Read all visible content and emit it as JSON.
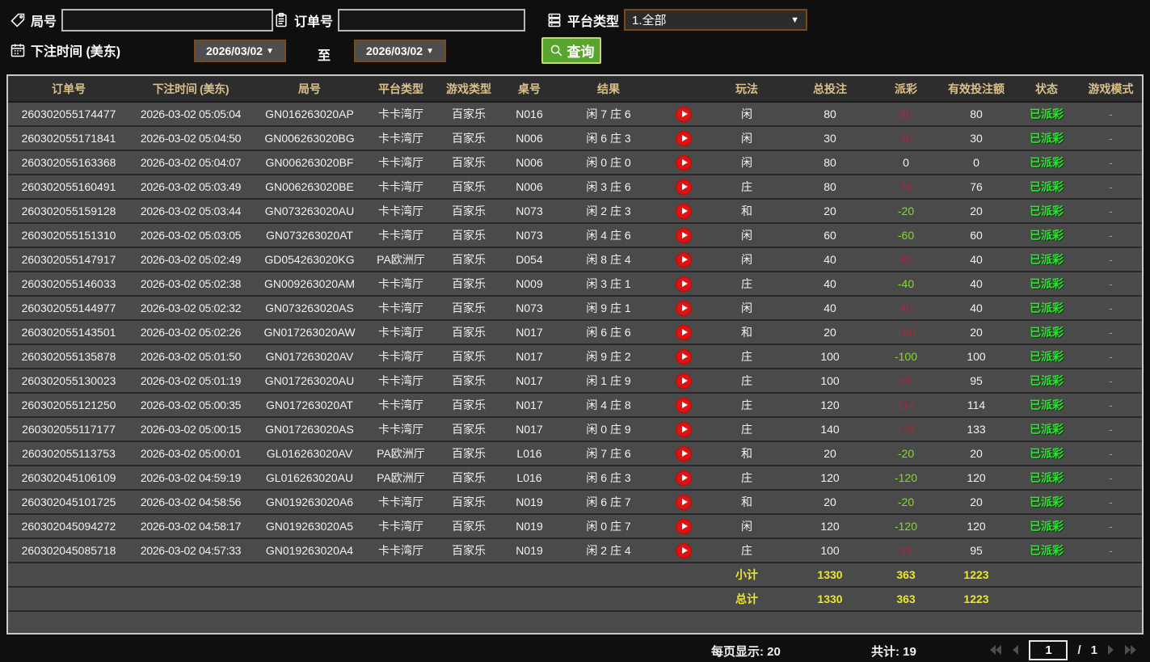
{
  "filters": {
    "round_label": "局号",
    "order_label": "订单号",
    "platform_label": "平台类型",
    "platform_value": "1.全部",
    "bet_time_label": "下注时间 (美东)",
    "date_from": "2026/03/02",
    "to_label": "至",
    "date_to": "2026/03/02",
    "search_label": "查询",
    "round_input_value": "",
    "order_input_value": ""
  },
  "icons": {
    "dropdown_arrow": "▼"
  },
  "colors": {
    "header_gold": "#d9c089",
    "status_green": "#2fe235",
    "payout_win_red": "#a42a3c",
    "payout_loss_green": "#7de01c",
    "summary_yellow": "#e9e72e",
    "search_button_green": "#58a52d",
    "control_border_brown": "#7c4a15",
    "row_bg": "#4a4a4a"
  },
  "table": {
    "headers": [
      "订单号",
      "下注时间 (美东)",
      "局号",
      "平台类型",
      "游戏类型",
      "桌号",
      "结果",
      "",
      "玩法",
      "总投注",
      "派彩",
      "有效投注额",
      "状态",
      "游戏模式"
    ],
    "rows": [
      {
        "order": "260302055174477",
        "time": "2026-03-02 05:05:04",
        "round": "GN016263020AP",
        "platform": "卡卡湾厅",
        "game": "百家乐",
        "table": "N016",
        "result": "闲 7 庄 6",
        "wager": "闲",
        "bet": "80",
        "payout": "80",
        "payout_class": "pos",
        "valid": "80",
        "status": "已派彩",
        "mode": "-"
      },
      {
        "order": "260302055171841",
        "time": "2026-03-02 05:04:50",
        "round": "GN006263020BG",
        "platform": "卡卡湾厅",
        "game": "百家乐",
        "table": "N006",
        "result": "闲 6 庄 3",
        "wager": "闲",
        "bet": "30",
        "payout": "30",
        "payout_class": "pos",
        "valid": "30",
        "status": "已派彩",
        "mode": "-"
      },
      {
        "order": "260302055163368",
        "time": "2026-03-02 05:04:07",
        "round": "GN006263020BF",
        "platform": "卡卡湾厅",
        "game": "百家乐",
        "table": "N006",
        "result": "闲 0 庄 0",
        "wager": "闲",
        "bet": "80",
        "payout": "0",
        "payout_class": "zero",
        "valid": "0",
        "status": "已派彩",
        "mode": "-"
      },
      {
        "order": "260302055160491",
        "time": "2026-03-02 05:03:49",
        "round": "GN006263020BE",
        "platform": "卡卡湾厅",
        "game": "百家乐",
        "table": "N006",
        "result": "闲 3 庄 6",
        "wager": "庄",
        "bet": "80",
        "payout": "76",
        "payout_class": "pos",
        "valid": "76",
        "status": "已派彩",
        "mode": "-"
      },
      {
        "order": "260302055159128",
        "time": "2026-03-02 05:03:44",
        "round": "GN073263020AU",
        "platform": "卡卡湾厅",
        "game": "百家乐",
        "table": "N073",
        "result": "闲 2 庄 3",
        "wager": "和",
        "bet": "20",
        "payout": "-20",
        "payout_class": "neg",
        "valid": "20",
        "status": "已派彩",
        "mode": "-"
      },
      {
        "order": "260302055151310",
        "time": "2026-03-02 05:03:05",
        "round": "GN073263020AT",
        "platform": "卡卡湾厅",
        "game": "百家乐",
        "table": "N073",
        "result": "闲 4 庄 6",
        "wager": "闲",
        "bet": "60",
        "payout": "-60",
        "payout_class": "neg",
        "valid": "60",
        "status": "已派彩",
        "mode": "-"
      },
      {
        "order": "260302055147917",
        "time": "2026-03-02 05:02:49",
        "round": "GD054263020KG",
        "platform": "PA欧洲厅",
        "game": "百家乐",
        "table": "D054",
        "result": "闲 8 庄 4",
        "wager": "闲",
        "bet": "40",
        "payout": "40",
        "payout_class": "pos",
        "valid": "40",
        "status": "已派彩",
        "mode": "-"
      },
      {
        "order": "260302055146033",
        "time": "2026-03-02 05:02:38",
        "round": "GN009263020AM",
        "platform": "卡卡湾厅",
        "game": "百家乐",
        "table": "N009",
        "result": "闲 3 庄 1",
        "wager": "庄",
        "bet": "40",
        "payout": "-40",
        "payout_class": "neg",
        "valid": "40",
        "status": "已派彩",
        "mode": "-"
      },
      {
        "order": "260302055144977",
        "time": "2026-03-02 05:02:32",
        "round": "GN073263020AS",
        "platform": "卡卡湾厅",
        "game": "百家乐",
        "table": "N073",
        "result": "闲 9 庄 1",
        "wager": "闲",
        "bet": "40",
        "payout": "40",
        "payout_class": "pos",
        "valid": "40",
        "status": "已派彩",
        "mode": "-"
      },
      {
        "order": "260302055143501",
        "time": "2026-03-02 05:02:26",
        "round": "GN017263020AW",
        "platform": "卡卡湾厅",
        "game": "百家乐",
        "table": "N017",
        "result": "闲 6 庄 6",
        "wager": "和",
        "bet": "20",
        "payout": "160",
        "payout_class": "pos",
        "valid": "20",
        "status": "已派彩",
        "mode": "-"
      },
      {
        "order": "260302055135878",
        "time": "2026-03-02 05:01:50",
        "round": "GN017263020AV",
        "platform": "卡卡湾厅",
        "game": "百家乐",
        "table": "N017",
        "result": "闲 9 庄 2",
        "wager": "庄",
        "bet": "100",
        "payout": "-100",
        "payout_class": "neg",
        "valid": "100",
        "status": "已派彩",
        "mode": "-"
      },
      {
        "order": "260302055130023",
        "time": "2026-03-02 05:01:19",
        "round": "GN017263020AU",
        "platform": "卡卡湾厅",
        "game": "百家乐",
        "table": "N017",
        "result": "闲 1 庄 9",
        "wager": "庄",
        "bet": "100",
        "payout": "95",
        "payout_class": "pos",
        "valid": "95",
        "status": "已派彩",
        "mode": "-"
      },
      {
        "order": "260302055121250",
        "time": "2026-03-02 05:00:35",
        "round": "GN017263020AT",
        "platform": "卡卡湾厅",
        "game": "百家乐",
        "table": "N017",
        "result": "闲 4 庄 8",
        "wager": "庄",
        "bet": "120",
        "payout": "114",
        "payout_class": "pos",
        "valid": "114",
        "status": "已派彩",
        "mode": "-"
      },
      {
        "order": "260302055117177",
        "time": "2026-03-02 05:00:15",
        "round": "GN017263020AS",
        "platform": "卡卡湾厅",
        "game": "百家乐",
        "table": "N017",
        "result": "闲 0 庄 9",
        "wager": "庄",
        "bet": "140",
        "payout": "133",
        "payout_class": "pos",
        "valid": "133",
        "status": "已派彩",
        "mode": "-"
      },
      {
        "order": "260302055113753",
        "time": "2026-03-02 05:00:01",
        "round": "GL016263020AV",
        "platform": "PA欧洲厅",
        "game": "百家乐",
        "table": "L016",
        "result": "闲 7 庄 6",
        "wager": "和",
        "bet": "20",
        "payout": "-20",
        "payout_class": "neg",
        "valid": "20",
        "status": "已派彩",
        "mode": "-"
      },
      {
        "order": "260302045106109",
        "time": "2026-03-02 04:59:19",
        "round": "GL016263020AU",
        "platform": "PA欧洲厅",
        "game": "百家乐",
        "table": "L016",
        "result": "闲 6 庄 3",
        "wager": "庄",
        "bet": "120",
        "payout": "-120",
        "payout_class": "neg",
        "valid": "120",
        "status": "已派彩",
        "mode": "-"
      },
      {
        "order": "260302045101725",
        "time": "2026-03-02 04:58:56",
        "round": "GN019263020A6",
        "platform": "卡卡湾厅",
        "game": "百家乐",
        "table": "N019",
        "result": "闲 6 庄 7",
        "wager": "和",
        "bet": "20",
        "payout": "-20",
        "payout_class": "neg",
        "valid": "20",
        "status": "已派彩",
        "mode": "-"
      },
      {
        "order": "260302045094272",
        "time": "2026-03-02 04:58:17",
        "round": "GN019263020A5",
        "platform": "卡卡湾厅",
        "game": "百家乐",
        "table": "N019",
        "result": "闲 0 庄 7",
        "wager": "闲",
        "bet": "120",
        "payout": "-120",
        "payout_class": "neg",
        "valid": "120",
        "status": "已派彩",
        "mode": "-"
      },
      {
        "order": "260302045085718",
        "time": "2026-03-02 04:57:33",
        "round": "GN019263020A4",
        "platform": "卡卡湾厅",
        "game": "百家乐",
        "table": "N019",
        "result": "闲 2 庄 4",
        "wager": "庄",
        "bet": "100",
        "payout": "95",
        "payout_class": "pos",
        "valid": "95",
        "status": "已派彩",
        "mode": "-"
      }
    ],
    "subtotal": {
      "label": "小计",
      "bet": "1330",
      "payout": "363",
      "valid": "1223"
    },
    "total": {
      "label": "总计",
      "bet": "1330",
      "payout": "363",
      "valid": "1223"
    }
  },
  "footer": {
    "per_page_label": "每页显示:",
    "per_page_value": "20",
    "total_label": "共计:",
    "total_value": "19",
    "page": "1",
    "separator": "/",
    "page_total": "1"
  }
}
